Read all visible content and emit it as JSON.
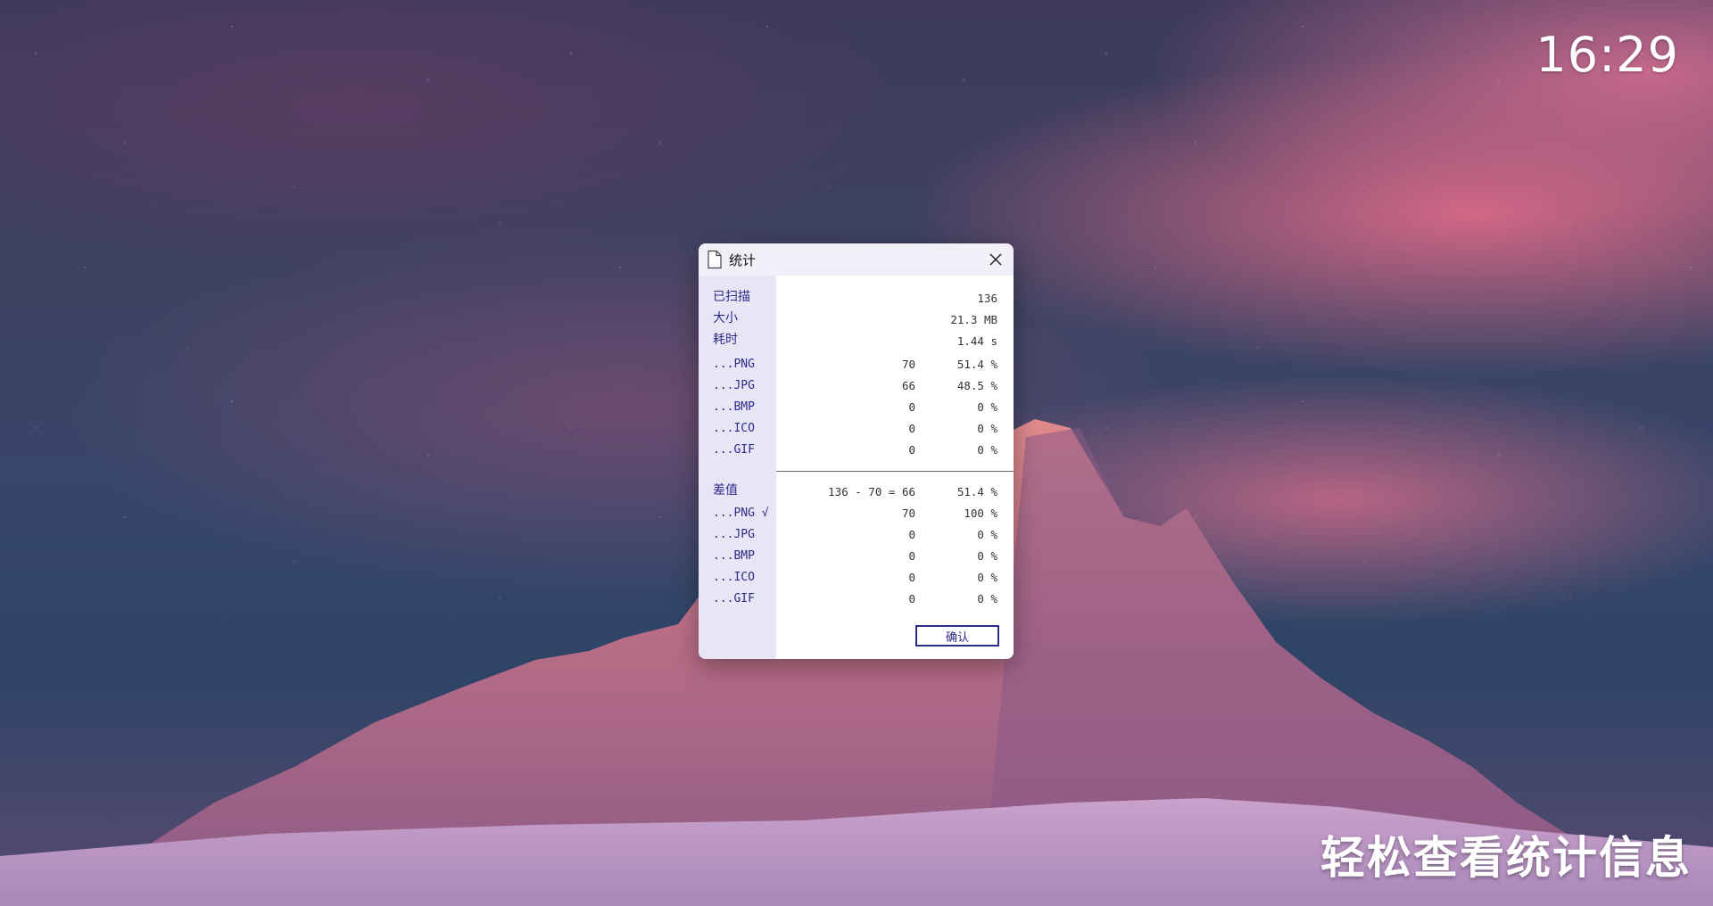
{
  "desktop": {
    "clock": "16:29",
    "caption": "轻松查看统计信息"
  },
  "dialog": {
    "title": "统计",
    "title_icon": "document-icon",
    "close_icon": "close-icon",
    "scan": {
      "scanned_label": "已扫描",
      "scanned_value": "136",
      "size_label": "大小",
      "size_value": "21.3 MB",
      "time_label": "耗时",
      "time_value": "1.44 s",
      "formats": [
        {
          "label": "...PNG",
          "count": "70",
          "percent": "51.4 %"
        },
        {
          "label": "...JPG",
          "count": "66",
          "percent": "48.5 %"
        },
        {
          "label": "...BMP",
          "count": "0",
          "percent": "0 %"
        },
        {
          "label": "...ICO",
          "count": "0",
          "percent": "0 %"
        },
        {
          "label": "...GIF",
          "count": "0",
          "percent": "0 %"
        }
      ]
    },
    "diff": {
      "label": "差值",
      "expression": "136 - 70 = 66",
      "percent": "51.4 %",
      "formats": [
        {
          "label": "...PNG √",
          "count": "70",
          "percent": "100 %"
        },
        {
          "label": "...JPG",
          "count": "0",
          "percent": "0 %"
        },
        {
          "label": "...BMP",
          "count": "0",
          "percent": "0 %"
        },
        {
          "label": "...ICO",
          "count": "0",
          "percent": "0 %"
        },
        {
          "label": "...GIF",
          "count": "0",
          "percent": "0 %"
        }
      ]
    },
    "confirm_label": "确认",
    "colors": {
      "accent": "#2d2a8a",
      "label_column": "#e8e6f5",
      "titlebar": "#f3eff8"
    }
  }
}
